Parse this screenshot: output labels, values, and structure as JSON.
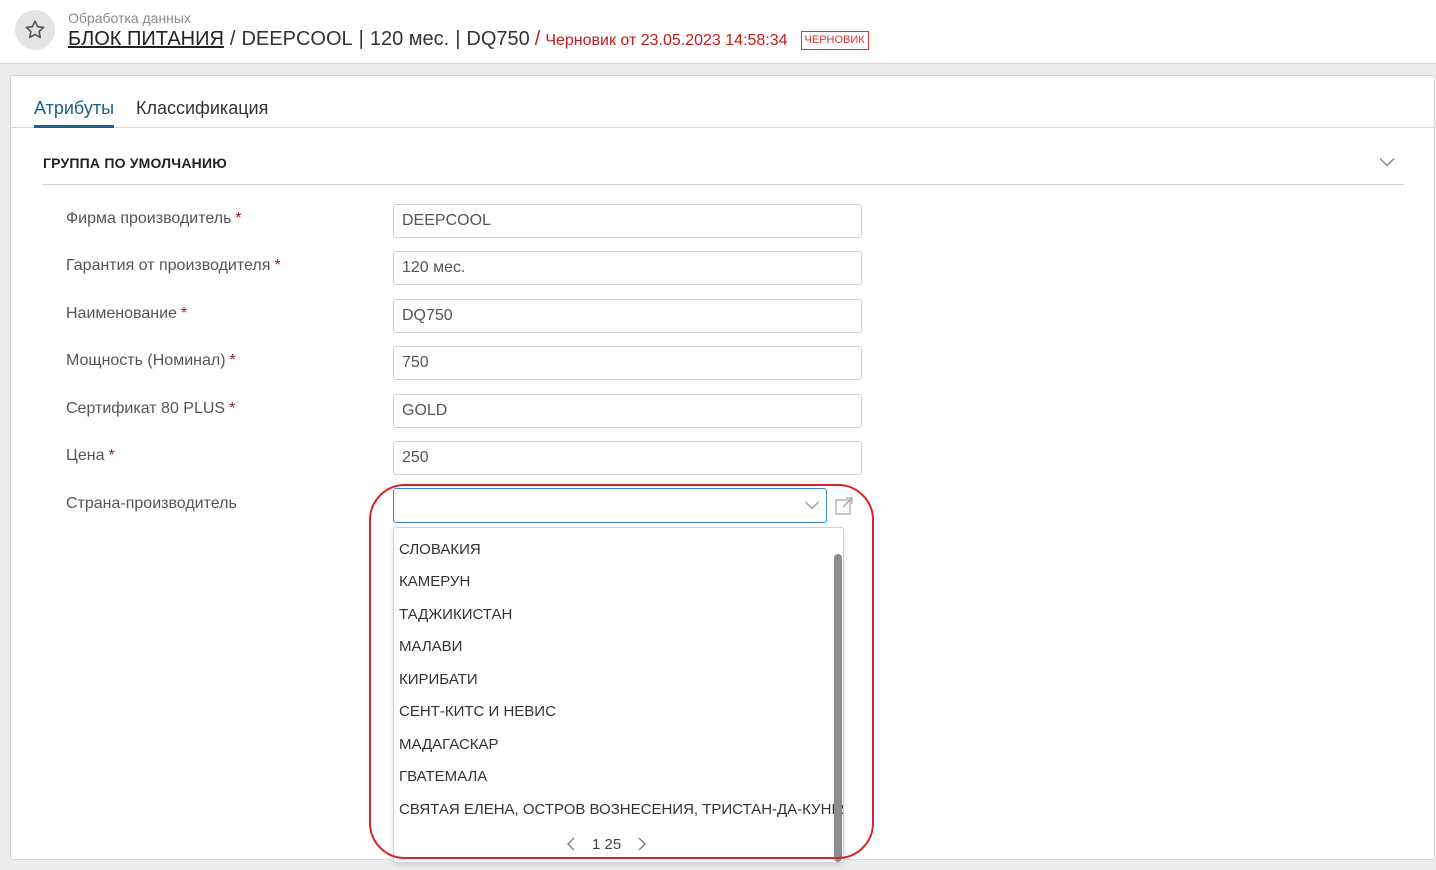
{
  "header": {
    "subtitle": "Обработка данных",
    "entity": "БЛОК ПИТАНИЯ",
    "separator": "/",
    "vendor": "DEEPCOOL",
    "pipe": "|",
    "warranty": "120 мес.",
    "model": "DQ750",
    "draft_separator": "/",
    "draft_text": "Черновик от 23.05.2023 14:58:34",
    "draft_badge": "ЧЕРНОВИК",
    "favorite_icon": "star-icon"
  },
  "tabs": [
    {
      "label": "Атрибуты",
      "active": true
    },
    {
      "label": "Классификация",
      "active": false
    }
  ],
  "group": {
    "title": "ГРУППА ПО УМОЛЧАНИЮ",
    "collapse_icon": "chevron-down-icon"
  },
  "fields": [
    {
      "label": "Фирма производитель",
      "required": "*",
      "value": "DEEPCOOL"
    },
    {
      "label": "Гарантия от производителя",
      "required": "*",
      "value": "120 мес."
    },
    {
      "label": "Наименование",
      "required": "*",
      "value": "DQ750"
    },
    {
      "label": "Мощность (Номинал)",
      "required": "*",
      "value": "750"
    },
    {
      "label": "Сертификат 80 PLUS",
      "required": "*",
      "value": "GOLD"
    },
    {
      "label": "Цена",
      "required": "*",
      "value": "250"
    }
  ],
  "country": {
    "label": "Страна-производитель",
    "value": "",
    "options": [
      "СЛОВАКИЯ",
      "КАМЕРУН",
      "ТАДЖИКИСТАН",
      "МАЛАВИ",
      "КИРИБАТИ",
      "СЕНТ-КИТС И НЕВИС",
      "МАДАГАСКАР",
      "ГВАТЕМАЛА",
      "СВЯТАЯ ЕЛЕНА, ОСТРОВ ВОЗНЕСЕНИЯ, ТРИСТАН-ДА-КУНЬЯ"
    ],
    "pager": "1 25"
  },
  "colors": {
    "accent": "#1d5f8c",
    "draft": "#c41a1a",
    "focus": "#3a86c6",
    "highlight": "#d9232f"
  }
}
